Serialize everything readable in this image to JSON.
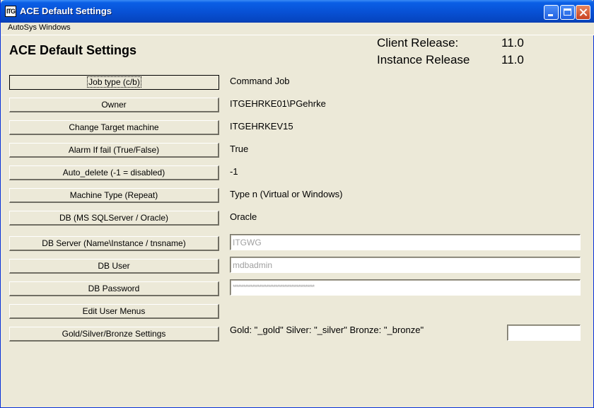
{
  "window": {
    "title": "ACE Default Settings",
    "icon_label": "ITG"
  },
  "menu": {
    "items": [
      "AutoSys Windows"
    ]
  },
  "heading": "ACE Default Settings",
  "release": {
    "client_label": "Client Release:",
    "client_value": "11.0",
    "instance_label": "Instance Release",
    "instance_value": "11.0"
  },
  "settings": [
    {
      "button": "Job type (c/b)",
      "value": "Command Job"
    },
    {
      "button": "Owner",
      "value": "ITGEHRKE01\\PGehrke"
    },
    {
      "button": "Change Target machine",
      "value": "ITGEHRKEV15"
    },
    {
      "button": "Alarm If fail (True/False)",
      "value": "True"
    },
    {
      "button": "Auto_delete (-1 = disabled)",
      "value": "-1"
    },
    {
      "button": "Machine Type (Repeat)",
      "value": "Type n (Virtual or Windows)"
    },
    {
      "button": "DB (MS SQLServer / Oracle)",
      "value": "Oracle"
    },
    {
      "button": "DB Server (Name\\Instance / tnsname)",
      "field": "ITGWG"
    },
    {
      "button": "DB User",
      "field": "mdbadmin"
    },
    {
      "button": "DB Password",
      "field": "**********************************************"
    },
    {
      "button": "Edit User Menus"
    },
    {
      "button": "Gold/Silver/Bronze Settings",
      "value": "Gold: \"_gold\" Silver: \"_silver\" Bronze: \"_bronze\"",
      "field": ""
    }
  ],
  "colors": {
    "titlebar": "#0852d6",
    "background": "#ece9d8",
    "field_text": "#a0a0a0"
  },
  "icons": [
    "minimize-icon",
    "maximize-icon",
    "close-icon"
  ]
}
